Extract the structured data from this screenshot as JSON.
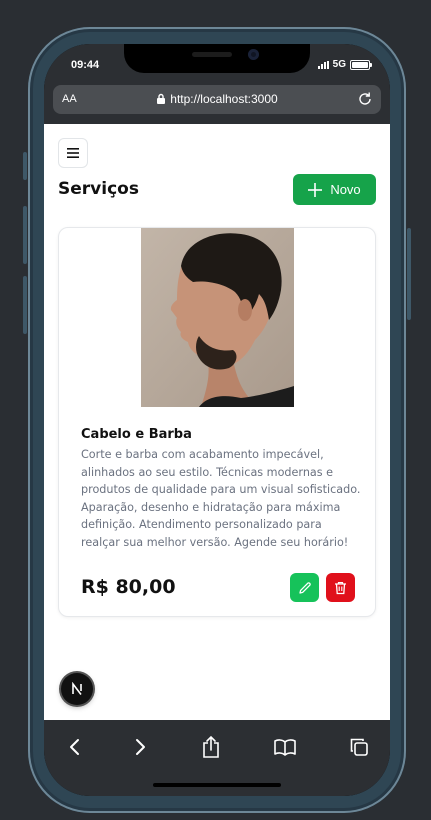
{
  "status_bar": {
    "time": "09:44",
    "network": "5G"
  },
  "browser": {
    "text_size_label": "AA",
    "url": "http://localhost:3000"
  },
  "page": {
    "title": "Serviços",
    "new_button_label": "Novo"
  },
  "service_card": {
    "name": "Cabelo e Barba",
    "description": "Corte e barba com acabamento impecável, alinhados ao seu estilo. Técnicas modernas e produtos de qualidade para um visual sofisticado. Aparação, desenho e hidratação para máxima definição. Atendimento personalizado para realçar sua melhor versão. Agende seu horário!",
    "price": "R$ 80,00"
  },
  "dev_badge": {
    "letter": "N"
  },
  "colors": {
    "accent_green": "#16a34a",
    "edit_green": "#16c25a",
    "delete_red": "#e0101b"
  }
}
